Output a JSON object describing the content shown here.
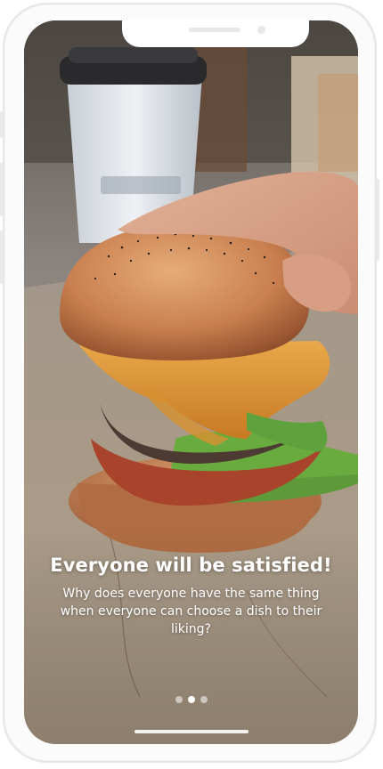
{
  "onboarding": {
    "title": "Everyone will be satisfied!",
    "description": "Why does everyone have the same thing when everyone can choose a dish to their liking?",
    "pages_total": 3,
    "active_page": 2
  },
  "image": {
    "subject": "burger-photo"
  },
  "colors": {
    "text": "#ffffff",
    "dot_active": "#ffffff",
    "dot_inactive": "#ffffff8c",
    "device_frame": "#fbfbfb"
  }
}
